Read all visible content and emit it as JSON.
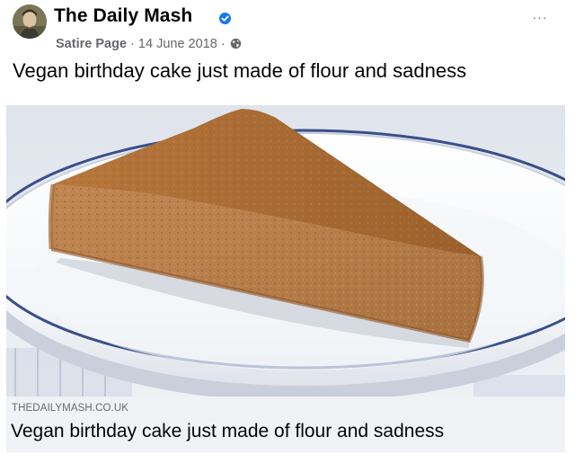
{
  "post": {
    "page_name": "The Daily Mash",
    "verified_icon": "verified-badge-icon",
    "category": "Satire Page",
    "separator": "·",
    "date": "14 June 2018",
    "audience_icon": "globe-icon",
    "more_label": "···",
    "text": "Vegan birthday cake just made of flour and sadness"
  },
  "link_preview": {
    "image_subject": "slice of sponge cake on a white plate",
    "domain": "THEDAILYMASH.CO.UK",
    "title": "Vegan birthday cake just made of flour and sadness"
  },
  "colors": {
    "verified_blue": "#1877f2",
    "secondary_text": "#65676b",
    "footer_bg": "#f0f2f5"
  }
}
